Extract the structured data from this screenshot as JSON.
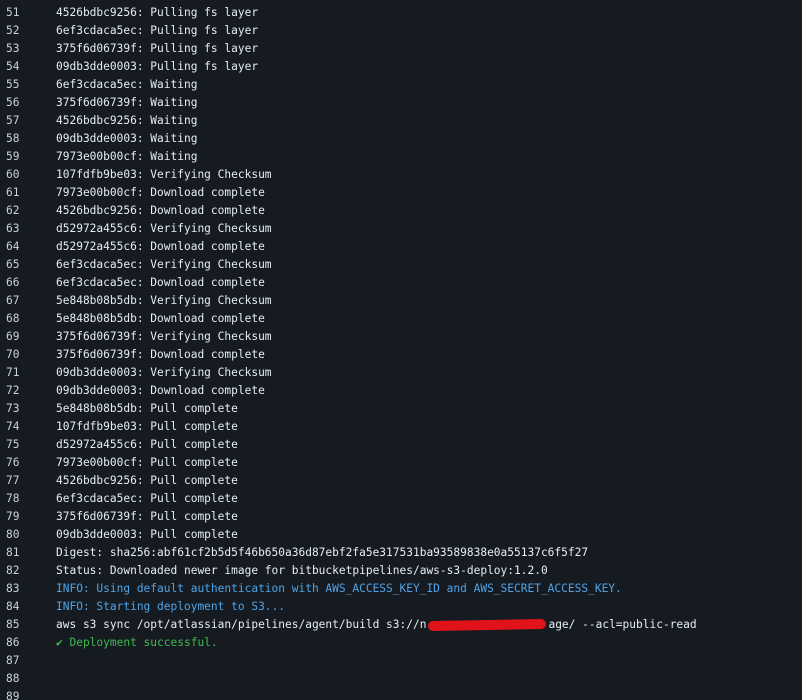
{
  "log": {
    "lines": [
      {
        "n": "51",
        "t": "4526bdbc9256: Pulling fs layer",
        "kind": "normal"
      },
      {
        "n": "52",
        "t": "6ef3cdaca5ec: Pulling fs layer",
        "kind": "normal"
      },
      {
        "n": "53",
        "t": "375f6d06739f: Pulling fs layer",
        "kind": "normal"
      },
      {
        "n": "54",
        "t": "09db3dde0003: Pulling fs layer",
        "kind": "normal"
      },
      {
        "n": "55",
        "t": "6ef3cdaca5ec: Waiting",
        "kind": "normal"
      },
      {
        "n": "56",
        "t": "375f6d06739f: Waiting",
        "kind": "normal"
      },
      {
        "n": "57",
        "t": "4526bdbc9256: Waiting",
        "kind": "normal"
      },
      {
        "n": "58",
        "t": "09db3dde0003: Waiting",
        "kind": "normal"
      },
      {
        "n": "59",
        "t": "7973e00b00cf: Waiting",
        "kind": "normal"
      },
      {
        "n": "60",
        "t": "107fdfb9be03: Verifying Checksum",
        "kind": "normal"
      },
      {
        "n": "61",
        "t": "7973e00b00cf: Download complete",
        "kind": "normal"
      },
      {
        "n": "62",
        "t": "4526bdbc9256: Download complete",
        "kind": "normal"
      },
      {
        "n": "63",
        "t": "d52972a455c6: Verifying Checksum",
        "kind": "normal"
      },
      {
        "n": "64",
        "t": "d52972a455c6: Download complete",
        "kind": "normal"
      },
      {
        "n": "65",
        "t": "6ef3cdaca5ec: Verifying Checksum",
        "kind": "normal"
      },
      {
        "n": "66",
        "t": "6ef3cdaca5ec: Download complete",
        "kind": "normal"
      },
      {
        "n": "67",
        "t": "5e848b08b5db: Verifying Checksum",
        "kind": "normal"
      },
      {
        "n": "68",
        "t": "5e848b08b5db: Download complete",
        "kind": "normal"
      },
      {
        "n": "69",
        "t": "375f6d06739f: Verifying Checksum",
        "kind": "normal"
      },
      {
        "n": "70",
        "t": "375f6d06739f: Download complete",
        "kind": "normal"
      },
      {
        "n": "71",
        "t": "09db3dde0003: Verifying Checksum",
        "kind": "normal"
      },
      {
        "n": "72",
        "t": "09db3dde0003: Download complete",
        "kind": "normal"
      },
      {
        "n": "73",
        "t": "5e848b08b5db: Pull complete",
        "kind": "normal"
      },
      {
        "n": "74",
        "t": "107fdfb9be03: Pull complete",
        "kind": "normal"
      },
      {
        "n": "75",
        "t": "d52972a455c6: Pull complete",
        "kind": "normal"
      },
      {
        "n": "76",
        "t": "7973e00b00cf: Pull complete",
        "kind": "normal"
      },
      {
        "n": "77",
        "t": "4526bdbc9256: Pull complete",
        "kind": "normal"
      },
      {
        "n": "78",
        "t": "6ef3cdaca5ec: Pull complete",
        "kind": "normal"
      },
      {
        "n": "79",
        "t": "375f6d06739f: Pull complete",
        "kind": "normal"
      },
      {
        "n": "80",
        "t": "09db3dde0003: Pull complete",
        "kind": "normal"
      },
      {
        "n": "81",
        "t": "Digest: sha256:abf61cf2b5d5f46b650a36d87ebf2fa5e317531ba93589838e0a55137c6f5f27",
        "kind": "normal"
      },
      {
        "n": "82",
        "t": "Status: Downloaded newer image for bitbucketpipelines/aws-s3-deploy:1.2.0",
        "kind": "normal"
      },
      {
        "n": "83",
        "t": "INFO: Using default authentication with AWS_ACCESS_KEY_ID and AWS_SECRET_ACCESS_KEY.",
        "kind": "info"
      },
      {
        "n": "84",
        "t": "INFO: Starting deployment to S3...",
        "kind": "info"
      },
      {
        "n": "85",
        "t_pre": "aws s3 sync /opt/atlassian/pipelines/agent/build s3://n",
        "t_post": "age/ --acl=public-read",
        "kind": "redacted"
      },
      {
        "n": "86",
        "t": "✔ Deployment successful.",
        "kind": "success"
      },
      {
        "n": "87",
        "t": "",
        "kind": "normal"
      },
      {
        "n": "88",
        "t": "",
        "kind": "normal"
      },
      {
        "n": "89",
        "t": "",
        "kind": "normal"
      }
    ]
  }
}
